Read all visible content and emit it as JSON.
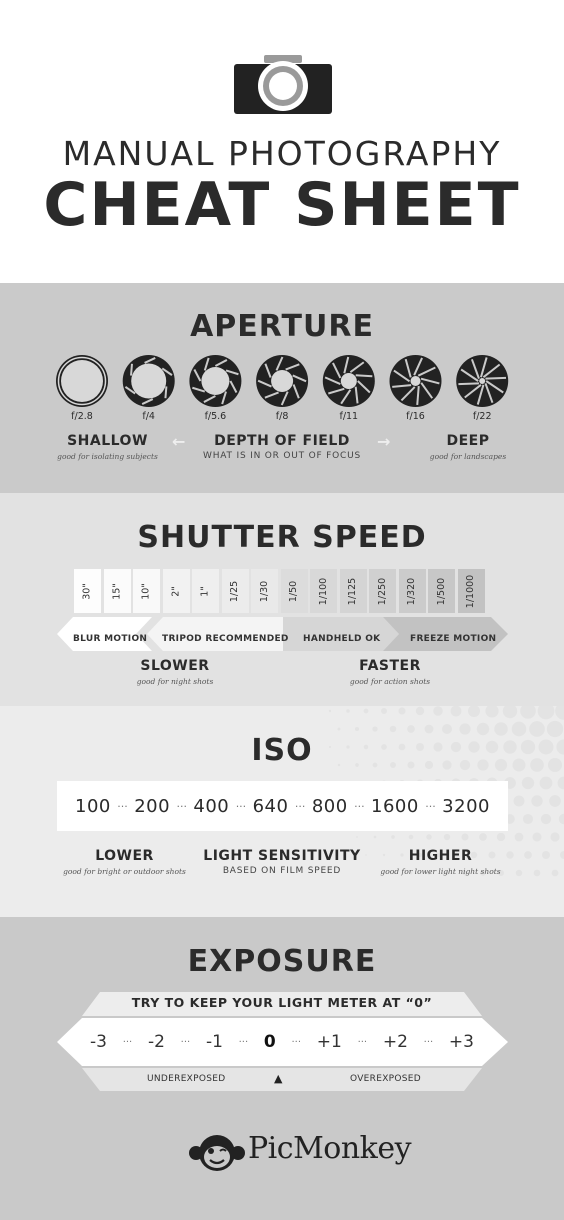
{
  "header": {
    "title_line1": "MANUAL PHOTOGRAPHY",
    "title_line2": "CHEAT SHEET"
  },
  "aperture": {
    "title": "APERTURE",
    "stops": [
      "f/2.8",
      "f/4",
      "f/5.6",
      "f/8",
      "f/11",
      "f/16",
      "f/22"
    ],
    "shallow": "SHALLOW",
    "shallow_sub": "good for isolating subjects",
    "dof": "DEPTH OF FIELD",
    "dof_sub": "WHAT IS IN OR OUT OF FOCUS",
    "deep": "DEEP",
    "deep_sub": "good for landscapes",
    "arrow_left": "←",
    "arrow_right": "→"
  },
  "shutter": {
    "title": "SHUTTER SPEED",
    "speeds": [
      "30\"",
      "15\"",
      "10\"",
      "2\"",
      "1\"",
      "1/25",
      "1/30",
      "1/50",
      "1/100",
      "1/125",
      "1/250",
      "1/320",
      "1/500",
      "1/1000"
    ],
    "blur": "BLUR MOTION",
    "tripod": "TRIPOD RECOMMENDED",
    "handheld": "HANDHELD OK",
    "freeze": "FREEZE MOTION",
    "slower": "SLOWER",
    "slower_sub": "good for night shots",
    "faster": "FASTER",
    "faster_sub": "good for action shots"
  },
  "iso": {
    "title": "ISO",
    "values": [
      "100",
      "200",
      "400",
      "640",
      "800",
      "1600",
      "3200"
    ],
    "separator": "···",
    "lower": "LOWER",
    "lower_sub": "good for bright or outdoor shots",
    "sens": "LIGHT SENSITIVITY",
    "sens_sub": "BASED ON FILM SPEED",
    "higher": "HIGHER",
    "higher_sub": "good for lower light night shots"
  },
  "exposure": {
    "title": "EXPOSURE",
    "tip": "TRY TO KEEP YOUR LIGHT METER AT “0”",
    "values": [
      "-3",
      "-2",
      "-1",
      "0",
      "+1",
      "+2",
      "+3"
    ],
    "under": "UNDEREXPOSED",
    "over": "OVEREXPOSED",
    "marker": "▲"
  },
  "footer": {
    "brand": "PicMonkey"
  },
  "colors": {
    "text": "#2b2b2b",
    "aperture_bg": "#cacaca",
    "shutter_bg": "#e2e2e2",
    "iso_bg": "#ececec",
    "exposure_bg": "#c9c9c9"
  }
}
